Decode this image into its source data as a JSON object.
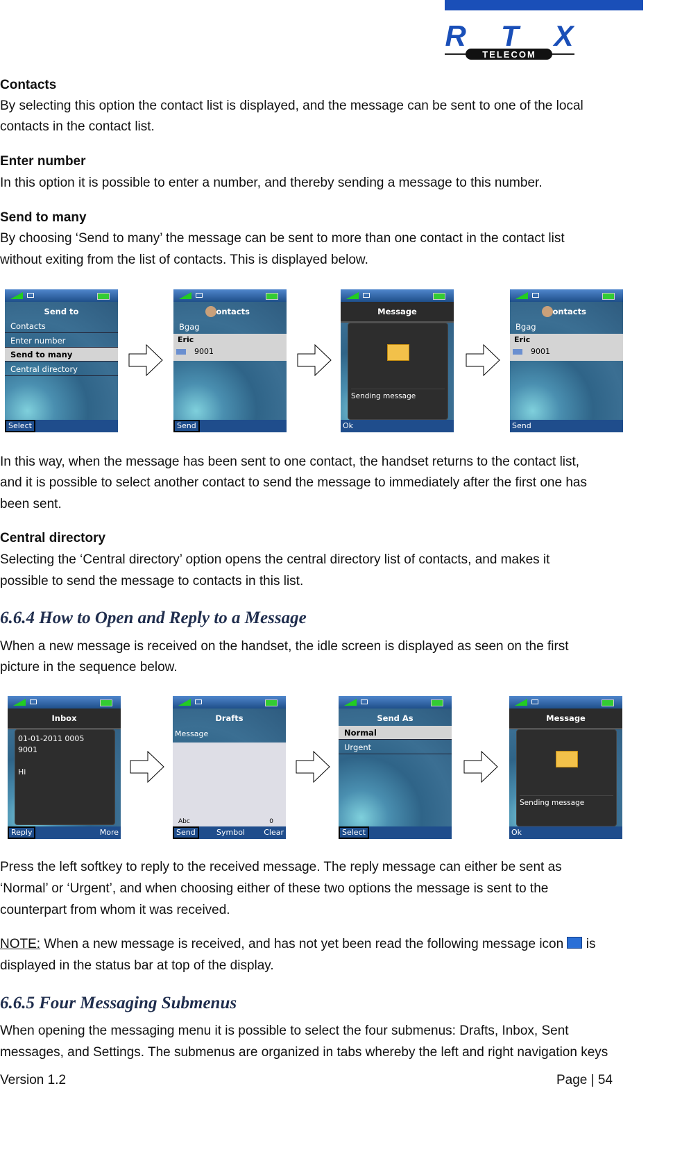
{
  "logo": {
    "brand": "RTX",
    "sub": "TELECOM",
    "color": "#1a4fb8"
  },
  "sections": [
    {
      "title": "Contacts",
      "lines": [
        "By selecting this option the contact list is displayed, and the message can be sent to one of the local",
        "contacts in the contact list."
      ]
    },
    {
      "title": "Enter number",
      "lines": [
        "In this option it is possible to enter a number, and thereby sending a message to this number."
      ]
    },
    {
      "title": "Send to many",
      "lines": [
        "By choosing ‘Send to many’ the message can be sent to more than one contact in the contact list",
        "without exiting from the list of contacts. This is displayed below."
      ]
    }
  ],
  "row1": [
    {
      "type": "menu",
      "title": "Send to",
      "items": [
        "Contacts",
        "Enter number",
        "Send to many",
        "Central directory"
      ],
      "selected": 2,
      "softkeys": [
        {
          "label": "Select",
          "boxed": true
        }
      ]
    },
    {
      "type": "contacts",
      "title": "Contacts",
      "items": [
        "Bgag"
      ],
      "sel_name": "Eric",
      "sel_number": "9001",
      "softkeys": [
        {
          "label": "Send",
          "boxed": true
        }
      ]
    },
    {
      "type": "popup",
      "title": "Message",
      "text": "Sending message",
      "softkeys": [
        {
          "label": "Ok",
          "boxed": false
        }
      ]
    },
    {
      "type": "contacts",
      "title": "Contacts",
      "items": [
        "Bgag"
      ],
      "sel_name": "Eric",
      "sel_number": "9001",
      "softkeys": [
        {
          "label": "Send",
          "boxed": false
        }
      ]
    }
  ],
  "after_row1": [
    "In this way, when the message has been sent to one contact, the handset returns to the contact list,",
    "and it is possible to select another contact to send the message to immediately after the first one has",
    "been sent."
  ],
  "central": {
    "title": "Central directory",
    "lines": [
      "Selecting the ‘Central directory’ option opens the central directory list of contacts, and makes it",
      "possible to send the message to contacts in this list."
    ]
  },
  "h664": "6.6.4 How to Open and Reply to a Message",
  "p664": [
    "When a new message is received on the handset, the idle screen is displayed as seen on the first",
    "picture in the sequence below."
  ],
  "row2": [
    {
      "type": "inbox",
      "title": "Inbox",
      "lines": [
        "01-01-2011 0005",
        "9001",
        "",
        "Hi"
      ],
      "softkeys": [
        {
          "label": "Reply",
          "boxed": true
        },
        {
          "label": "More",
          "boxed": false
        }
      ]
    },
    {
      "type": "drafts",
      "title": "Drafts",
      "label": "Message",
      "mode": "Abc",
      "count": "0",
      "softkeys": [
        {
          "label": "Send",
          "boxed": true
        },
        {
          "label": "Symbol",
          "boxed": false
        },
        {
          "label": "Clear",
          "boxed": false
        }
      ]
    },
    {
      "type": "menu",
      "title": "Send As",
      "items": [
        "Normal",
        "Urgent"
      ],
      "selected": 0,
      "softkeys": [
        {
          "label": "Select",
          "boxed": true
        }
      ]
    },
    {
      "type": "popup",
      "title": "Message",
      "text": "Sending message",
      "softkeys": [
        {
          "label": "Ok",
          "boxed": false
        }
      ]
    }
  ],
  "after_row2": [
    "Press the left softkey to reply to the received message. The reply message can either be sent as",
    "‘Normal’ or ‘Urgent’, and when choosing either of these two options the message is sent to the",
    "counterpart from whom it was received."
  ],
  "note": {
    "label": "NOTE:",
    "text1": " When a new message is received, and has not yet been read the following message icon ",
    "text2": " is",
    "line2": "displayed in the status bar at top of the display."
  },
  "h665": "6.6.5 Four Messaging Submenus",
  "p665": [
    "When opening the messaging menu it is possible to select the four submenus: Drafts, Inbox, Sent",
    "messages, and Settings. The submenus are organized in tabs whereby the left and right navigation keys"
  ],
  "footer": {
    "version": "Version 1.2",
    "page": "Page | 54"
  }
}
